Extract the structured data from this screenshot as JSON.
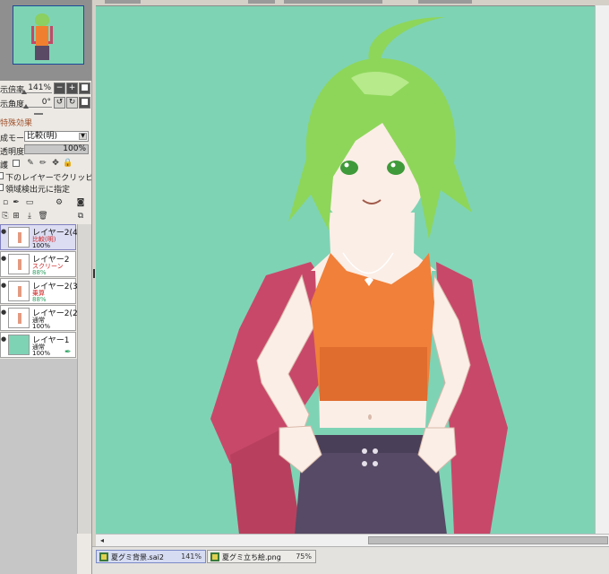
{
  "navigator": {
    "zoom_label": "示倍率",
    "zoom_value": "141%",
    "zoom_minus": "−",
    "zoom_plus": "+",
    "zoom_fit": "■",
    "angle_label": "示角度",
    "angle_value": "0°",
    "angle_ccw": "↺",
    "angle_cw": "↻",
    "angle_reset": "■"
  },
  "effects": {
    "title": "特殊効果"
  },
  "layer_props": {
    "mode_label": "成モード",
    "mode_value": "比較(明)",
    "opacity_label": "透明度",
    "opacity_value": "100%",
    "protect_label": "護",
    "clipping_label": "下のレイヤーでクリッピング",
    "selection_source_label": "領域検出元に指定"
  },
  "layers": [
    {
      "name": "レイヤー2(4)",
      "mode": "比較(明)",
      "opacity": "100%",
      "mode_color": "#cc2222",
      "op_color": "#111111",
      "selected": true
    },
    {
      "name": "レイヤー2",
      "mode": "スクリーン",
      "opacity": "88%",
      "mode_color": "#cc2222",
      "op_color": "#2aa060",
      "selected": false
    },
    {
      "name": "レイヤー2(3)",
      "mode": "乗算",
      "opacity": "88%",
      "mode_color": "#cc2222",
      "op_color": "#2aa060",
      "selected": false
    },
    {
      "name": "レイヤー2(2)",
      "mode": "通常",
      "opacity": "100%",
      "mode_color": "#111111",
      "op_color": "#111111",
      "selected": false
    },
    {
      "name": "レイヤー1",
      "mode": "通常",
      "opacity": "100%",
      "mode_color": "#111111",
      "op_color": "#111111",
      "selected": false
    }
  ],
  "file_tabs": [
    {
      "name": "夏グミ背景.sai2",
      "zoom": "141%",
      "active": true
    },
    {
      "name": "夏グミ立ち絵.png",
      "zoom": "75%",
      "active": false
    }
  ],
  "colors": {
    "canvas_bg": "#7ed3b5",
    "hair": "#8ed65a",
    "top": "#f0803a",
    "jacket": "#c8486a",
    "pants": "#564a66",
    "skin": "#fbeee6"
  }
}
